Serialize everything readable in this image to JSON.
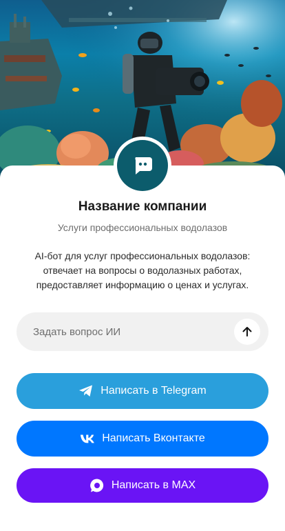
{
  "company": {
    "name": "Название компании",
    "subtitle": "Услуги профессиональных водолазов",
    "description": "AI-бот для услуг профессиональных водолазов: отвечает на вопросы о водолазных работах, предоставляет информацию о ценах и услугах."
  },
  "ask": {
    "placeholder": "Задать вопрос ИИ"
  },
  "buttons": {
    "telegram": "Написать в Telegram",
    "vk": "Написать Вконтакте",
    "max": "Написать в MAX"
  },
  "colors": {
    "telegram": "#2a9fdc",
    "vk": "#0077ff",
    "max": "#6a14f5",
    "avatar": "#0c5c6c"
  },
  "icons": {
    "avatar": "chat-bubble-icon",
    "send": "arrow-up-icon",
    "telegram": "telegram-icon",
    "vk": "vk-icon",
    "max": "max-icon"
  }
}
